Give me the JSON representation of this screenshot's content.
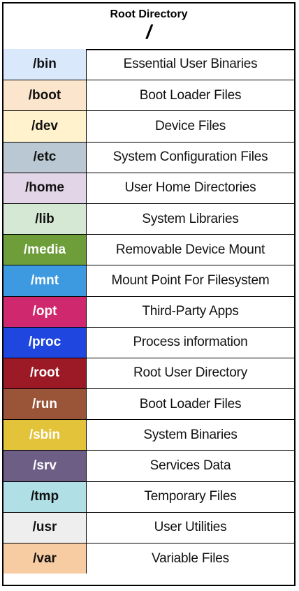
{
  "header": {
    "title": "Root Directory",
    "symbol": "/"
  },
  "rows": [
    {
      "dir": "/bin",
      "description": "Essential User Binaries",
      "color": "#dae8fc",
      "text_color": "#111111"
    },
    {
      "dir": "/boot",
      "description": "Boot Loader Files",
      "color": "#fce5cd",
      "text_color": "#111111"
    },
    {
      "dir": "/dev",
      "description": "Device Files",
      "color": "#fff2cc",
      "text_color": "#111111"
    },
    {
      "dir": "/etc",
      "description": "System Configuration Files",
      "color": "#bac8d3",
      "text_color": "#111111"
    },
    {
      "dir": "/home",
      "description": "User Home Directories",
      "color": "#e1d5e7",
      "text_color": "#111111"
    },
    {
      "dir": "/lib",
      "description": "System Libraries",
      "color": "#d5e8d4",
      "text_color": "#111111"
    },
    {
      "dir": "/media",
      "description": "Removable Device Mount",
      "color": "#6d9e3a",
      "text_color": "#ffffff"
    },
    {
      "dir": "/mnt",
      "description": "Mount Point For Filesystem",
      "color": "#3e9ae0",
      "text_color": "#ffffff"
    },
    {
      "dir": "/opt",
      "description": "Third-Party Apps",
      "color": "#d0286e",
      "text_color": "#ffffff"
    },
    {
      "dir": "/proc",
      "description": "Process information",
      "color": "#1f47e0",
      "text_color": "#ffffff"
    },
    {
      "dir": "/root",
      "description": "Root User Directory",
      "color": "#9b1a26",
      "text_color": "#ffffff"
    },
    {
      "dir": "/run",
      "description": "Boot Loader Files",
      "color": "#9a5538",
      "text_color": "#ffffff"
    },
    {
      "dir": "/sbin",
      "description": "System Binaries",
      "color": "#e3c33a",
      "text_color": "#ffffff"
    },
    {
      "dir": "/srv",
      "description": "Services Data",
      "color": "#6d5e86",
      "text_color": "#ffffff"
    },
    {
      "dir": "/tmp",
      "description": "Temporary Files",
      "color": "#b0e0e6",
      "text_color": "#111111"
    },
    {
      "dir": "/usr",
      "description": "User Utilities",
      "color": "#eeeeee",
      "text_color": "#111111"
    },
    {
      "dir": "/var",
      "description": "Variable Files",
      "color": "#f8cca2",
      "text_color": "#111111"
    }
  ]
}
